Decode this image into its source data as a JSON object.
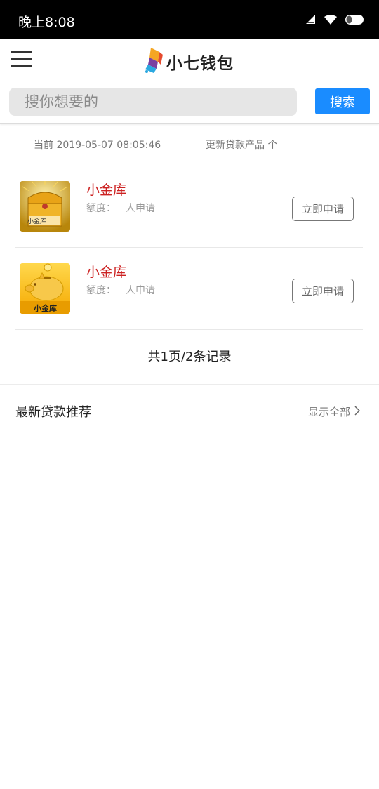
{
  "status_bar": {
    "time": "晚上8:08"
  },
  "header": {
    "menu_icon": "hamburger-menu-icon",
    "logo_text": "小七钱包",
    "search": {
      "placeholder": "搜你想要的",
      "button_label": "搜索"
    }
  },
  "info": {
    "current_time": "当前 2019-05-07 08:05:46",
    "update_text": "更新贷款产品 个"
  },
  "products": [
    {
      "name": "小金库",
      "quota_label": "额度：",
      "quota_value": "人申请",
      "icon_label": "小金库",
      "icon": "treasure-chest-icon",
      "apply_label": "立即申请"
    },
    {
      "name": "小金库",
      "quota_label": "额度：",
      "quota_value": "人申请",
      "icon_label": "小金库",
      "icon": "piggy-bank-icon",
      "apply_label": "立即申请"
    }
  ],
  "pagination": {
    "text": "共1页/2条记录"
  },
  "recommend": {
    "title": "最新贷款推荐",
    "show_all": "显示全部"
  },
  "colors": {
    "accent": "#1a8cff",
    "product_name": "#cc2222",
    "status_bar": "#000000"
  }
}
